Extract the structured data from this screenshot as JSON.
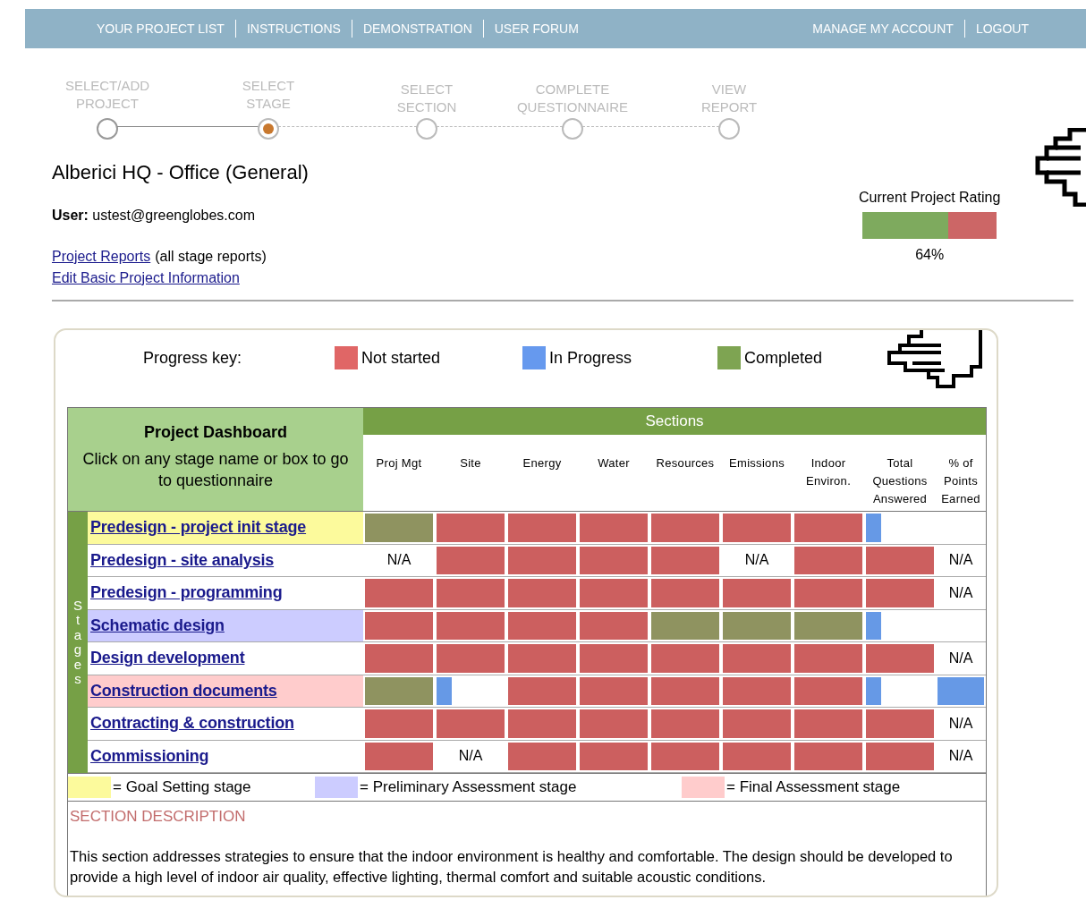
{
  "nav": {
    "left": [
      "YOUR PROJECT LIST",
      "INSTRUCTIONS",
      "DEMONSTRATION",
      "USER FORUM"
    ],
    "right": [
      "MANAGE MY ACCOUNT",
      "LOGOUT"
    ]
  },
  "steps": [
    {
      "label": "SELECT/ADD PROJECT",
      "selected": false,
      "done": true
    },
    {
      "label": "SELECT STAGE",
      "selected": true,
      "done": true
    },
    {
      "label": "SELECT SECTION",
      "selected": false,
      "done": false
    },
    {
      "label": "COMPLETE QUESTIONNAIRE",
      "selected": false,
      "done": false
    },
    {
      "label": "VIEW REPORT",
      "selected": false,
      "done": false
    }
  ],
  "project_title": "Alberici HQ - Office (General)",
  "user": {
    "label": "User:",
    "value": "ustest@greenglobes.com"
  },
  "links": [
    {
      "link": "Project Reports",
      "note": "(all stage reports)"
    },
    {
      "link": "Edit Basic Project Information"
    }
  ],
  "rating": {
    "title": "Current Project Rating",
    "level": 0.64,
    "reading": "64%"
  },
  "progress_key": {
    "label": "Progress key:",
    "items": [
      {
        "label": "Not started",
        "color": "#e06666"
      },
      {
        "label": "In Progress",
        "color": "#6699ee"
      },
      {
        "label": "Completed",
        "color": "#7ea452"
      }
    ]
  },
  "dashboard": {
    "title": "Project Dashboard",
    "hint": "Click on any stage name or box to go to questionnaire",
    "sections_label": "Sections",
    "stages_label": "Stages",
    "columns": [
      "Proj Mgt",
      "Site",
      "Energy",
      "Water",
      "Resources",
      "Emissions",
      "Indoor Environ.",
      "Total Questions Answered",
      "% of Points Earned"
    ],
    "rows": [
      {
        "stage": "Predesign - project init stage",
        "kind": "goal",
        "cells": [
          {
            "kind": "completed"
          },
          {
            "kind": "not_started"
          },
          {
            "kind": "not_started"
          },
          {
            "kind": "not_started"
          },
          {
            "kind": "not_started"
          },
          {
            "kind": "not_started"
          },
          {
            "kind": "not_started"
          },
          {
            "kind": "in_progress",
            "partial": true
          },
          {
            "kind": "empty"
          }
        ]
      },
      {
        "stage": "Predesign - site analysis",
        "kind": "plain",
        "cells": [
          {
            "kind": "na",
            "text": "N/A"
          },
          {
            "kind": "not_started"
          },
          {
            "kind": "not_started"
          },
          {
            "kind": "not_started"
          },
          {
            "kind": "not_started"
          },
          {
            "kind": "na",
            "text": "N/A"
          },
          {
            "kind": "not_started"
          },
          {
            "kind": "not_started"
          },
          {
            "kind": "na",
            "text": "N/A"
          }
        ]
      },
      {
        "stage": "Predesign - programming",
        "kind": "plain",
        "cells": [
          {
            "kind": "not_started"
          },
          {
            "kind": "not_started"
          },
          {
            "kind": "not_started"
          },
          {
            "kind": "not_started"
          },
          {
            "kind": "not_started"
          },
          {
            "kind": "not_started"
          },
          {
            "kind": "not_started"
          },
          {
            "kind": "not_started"
          },
          {
            "kind": "na",
            "text": "N/A"
          }
        ]
      },
      {
        "stage": "Schematic design",
        "kind": "preliminary",
        "cells": [
          {
            "kind": "not_started"
          },
          {
            "kind": "not_started"
          },
          {
            "kind": "not_started"
          },
          {
            "kind": "not_started"
          },
          {
            "kind": "completed"
          },
          {
            "kind": "completed"
          },
          {
            "kind": "completed"
          },
          {
            "kind": "in_progress",
            "partial": true
          },
          {
            "kind": "empty"
          }
        ]
      },
      {
        "stage": "Design development",
        "kind": "plain",
        "cells": [
          {
            "kind": "not_started"
          },
          {
            "kind": "not_started"
          },
          {
            "kind": "not_started"
          },
          {
            "kind": "not_started"
          },
          {
            "kind": "not_started"
          },
          {
            "kind": "not_started"
          },
          {
            "kind": "not_started"
          },
          {
            "kind": "not_started"
          },
          {
            "kind": "na",
            "text": "N/A"
          }
        ]
      },
      {
        "stage": "Construction documents",
        "kind": "final",
        "cells": [
          {
            "kind": "completed"
          },
          {
            "kind": "in_progress",
            "partial": true
          },
          {
            "kind": "not_started"
          },
          {
            "kind": "not_started"
          },
          {
            "kind": "not_started"
          },
          {
            "kind": "not_started"
          },
          {
            "kind": "not_started"
          },
          {
            "kind": "in_progress",
            "partial": true
          },
          {
            "kind": "in_progress",
            "partial": false
          }
        ]
      },
      {
        "stage": "Contracting & construction",
        "kind": "plain",
        "cells": [
          {
            "kind": "not_started"
          },
          {
            "kind": "not_started"
          },
          {
            "kind": "not_started"
          },
          {
            "kind": "not_started"
          },
          {
            "kind": "not_started"
          },
          {
            "kind": "not_started"
          },
          {
            "kind": "not_started"
          },
          {
            "kind": "not_started"
          },
          {
            "kind": "na",
            "text": "N/A"
          }
        ]
      },
      {
        "stage": "Commissioning",
        "kind": "plain",
        "cells": [
          {
            "kind": "not_started"
          },
          {
            "kind": "na",
            "text": "N/A"
          },
          {
            "kind": "not_started"
          },
          {
            "kind": "not_started"
          },
          {
            "kind": "not_started"
          },
          {
            "kind": "not_started"
          },
          {
            "kind": "not_started"
          },
          {
            "kind": "not_started"
          },
          {
            "kind": "na",
            "text": "N/A"
          }
        ]
      }
    ],
    "legend": [
      {
        "kind": "goal",
        "label": "= Goal Setting stage"
      },
      {
        "kind": "preliminary",
        "label": "= Preliminary Assessment stage"
      },
      {
        "kind": "final",
        "label": "= Final Assessment stage"
      }
    ],
    "description": {
      "title": "SECTION DESCRIPTION",
      "text": "This section addresses strategies to ensure that the indoor environment is healthy and comfortable. The design should be developed to provide a high level of indoor air quality, effective lighting, thermal comfort and suitable acoustic conditions."
    }
  }
}
